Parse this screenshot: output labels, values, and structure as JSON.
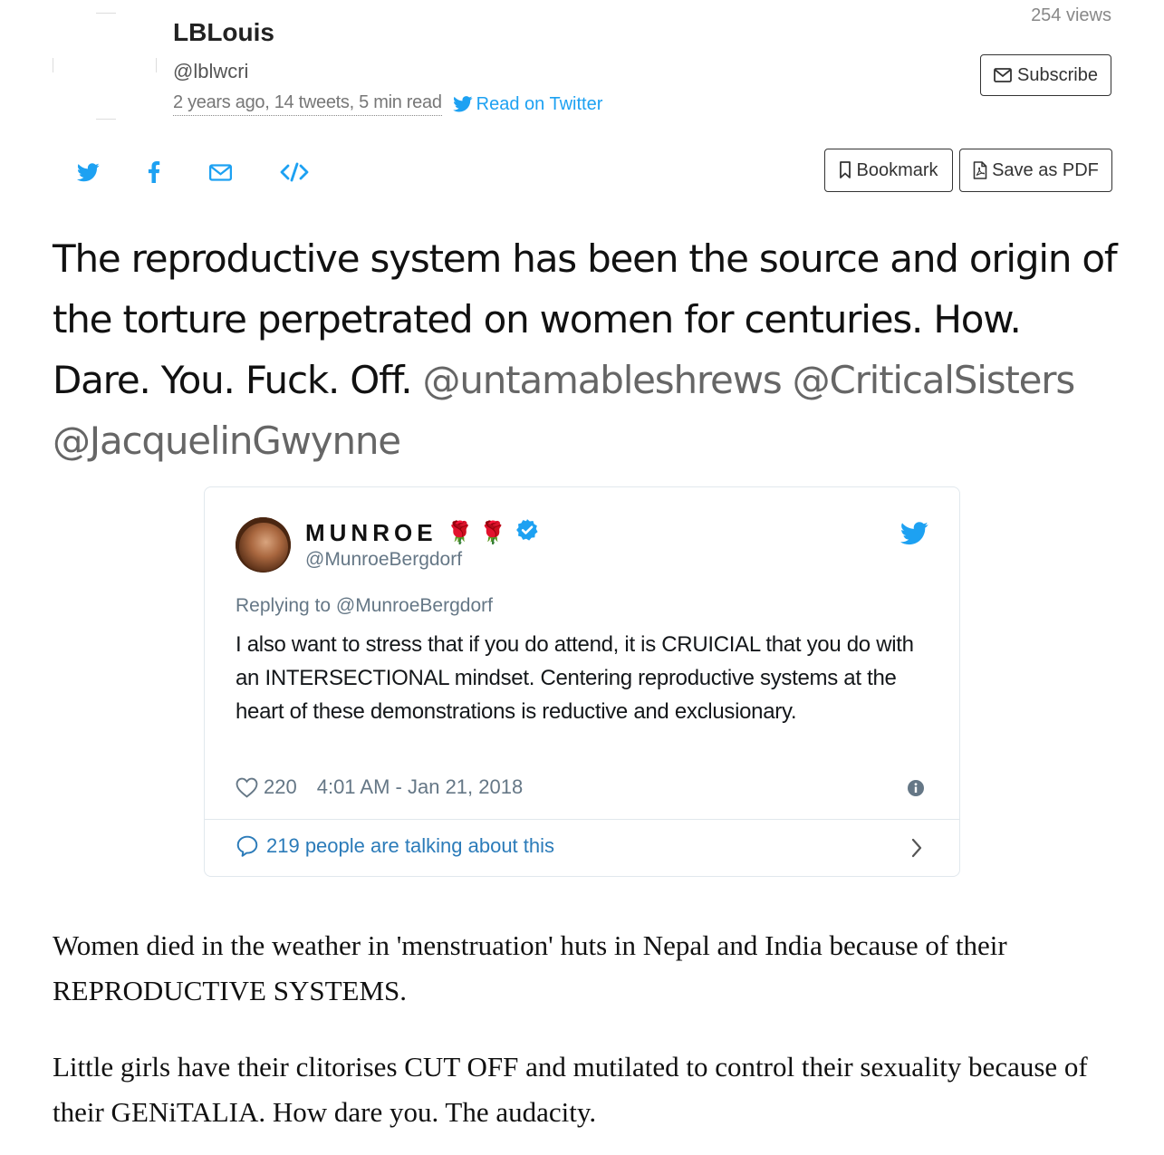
{
  "header": {
    "author_name": "LBLouis",
    "author_handle": "@lblwcri",
    "meta_text": "2 years ago, 14 tweets, 5 min read",
    "read_on_twitter": "Read on Twitter",
    "views": "254 views",
    "subscribe_label": "Subscribe"
  },
  "share": {
    "icons": [
      "twitter-icon",
      "facebook-icon",
      "email-icon",
      "embed-code-icon"
    ],
    "bookmark_label": "Bookmark",
    "save_pdf_label": "Save as PDF"
  },
  "lead": {
    "text": "The reproductive system has been the source and origin of the torture perpetrated on women for centuries. How. Dare. You. Fuck. Off.",
    "mentions": "@untamableshrews @CriticalSisters @JacquelinGwynne"
  },
  "embed": {
    "name": "MUNROE",
    "emojis": "🌹 🌹",
    "handle": "@MunroeBergdorf",
    "replying_to": "Replying to @MunroeBergdorf",
    "body": "I also want to stress that if you do attend, it is CRUICIAL that you do with an INTERSECTIONAL mindset. Centering reproductive systems at the heart of these demonstrations is reductive and exclusionary.",
    "likes": "220",
    "timestamp": "4:01 AM - Jan 21, 2018",
    "talking": "219 people are talking about this"
  },
  "paragraphs": {
    "p1": "Women died in the weather in 'menstruation' huts in Nepal and India because of their REPRODUCTIVE SYSTEMS.",
    "p2": "Little girls have their clitorises CUT OFF and mutilated to control their sexuality because of their GENiTALIA. How dare you. The audacity."
  },
  "colors": {
    "twitter_blue": "#1da1f2",
    "link_blue": "#2b7bb9",
    "muted": "#657786"
  }
}
